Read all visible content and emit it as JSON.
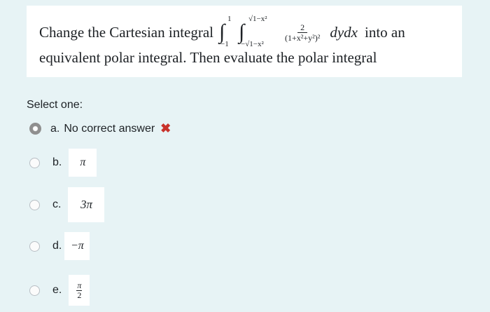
{
  "question": {
    "prefix": "Change the Cartesian integral",
    "outer_lower": "−1",
    "outer_upper": "1",
    "inner_lower": "−√1−x²",
    "inner_upper": "√1−x²",
    "integrand_num": "2",
    "integrand_den": "(1+x²+y²)²",
    "differentials": "dydx",
    "suffix": "into an",
    "line2": "equivalent polar integral. Then evaluate  the polar integral"
  },
  "select_label": "Select one:",
  "options": [
    {
      "letter": "a.",
      "text": "No correct answer",
      "selected": true,
      "marked_wrong": true,
      "mark": "✖"
    },
    {
      "letter": "b.",
      "text": "π"
    },
    {
      "letter": "c.",
      "text": "3π"
    },
    {
      "letter": "d.",
      "text": "−π"
    },
    {
      "letter": "e.",
      "text_num": "π",
      "text_den": "2"
    }
  ],
  "colors": {
    "background": "#e7f3f5",
    "wrong_mark": "#c8322b"
  }
}
